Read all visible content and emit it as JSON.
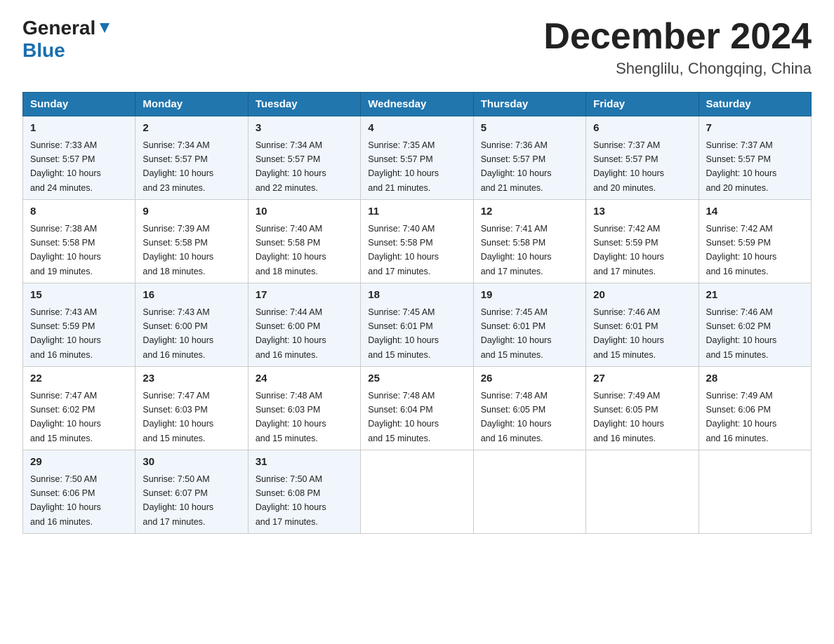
{
  "header": {
    "logo_general": "General",
    "logo_blue": "Blue",
    "month_title": "December 2024",
    "location": "Shenglilu, Chongqing, China"
  },
  "weekdays": [
    "Sunday",
    "Monday",
    "Tuesday",
    "Wednesday",
    "Thursday",
    "Friday",
    "Saturday"
  ],
  "weeks": [
    [
      {
        "day": "1",
        "info": "Sunrise: 7:33 AM\nSunset: 5:57 PM\nDaylight: 10 hours\nand 24 minutes."
      },
      {
        "day": "2",
        "info": "Sunrise: 7:34 AM\nSunset: 5:57 PM\nDaylight: 10 hours\nand 23 minutes."
      },
      {
        "day": "3",
        "info": "Sunrise: 7:34 AM\nSunset: 5:57 PM\nDaylight: 10 hours\nand 22 minutes."
      },
      {
        "day": "4",
        "info": "Sunrise: 7:35 AM\nSunset: 5:57 PM\nDaylight: 10 hours\nand 21 minutes."
      },
      {
        "day": "5",
        "info": "Sunrise: 7:36 AM\nSunset: 5:57 PM\nDaylight: 10 hours\nand 21 minutes."
      },
      {
        "day": "6",
        "info": "Sunrise: 7:37 AM\nSunset: 5:57 PM\nDaylight: 10 hours\nand 20 minutes."
      },
      {
        "day": "7",
        "info": "Sunrise: 7:37 AM\nSunset: 5:57 PM\nDaylight: 10 hours\nand 20 minutes."
      }
    ],
    [
      {
        "day": "8",
        "info": "Sunrise: 7:38 AM\nSunset: 5:58 PM\nDaylight: 10 hours\nand 19 minutes."
      },
      {
        "day": "9",
        "info": "Sunrise: 7:39 AM\nSunset: 5:58 PM\nDaylight: 10 hours\nand 18 minutes."
      },
      {
        "day": "10",
        "info": "Sunrise: 7:40 AM\nSunset: 5:58 PM\nDaylight: 10 hours\nand 18 minutes."
      },
      {
        "day": "11",
        "info": "Sunrise: 7:40 AM\nSunset: 5:58 PM\nDaylight: 10 hours\nand 17 minutes."
      },
      {
        "day": "12",
        "info": "Sunrise: 7:41 AM\nSunset: 5:58 PM\nDaylight: 10 hours\nand 17 minutes."
      },
      {
        "day": "13",
        "info": "Sunrise: 7:42 AM\nSunset: 5:59 PM\nDaylight: 10 hours\nand 17 minutes."
      },
      {
        "day": "14",
        "info": "Sunrise: 7:42 AM\nSunset: 5:59 PM\nDaylight: 10 hours\nand 16 minutes."
      }
    ],
    [
      {
        "day": "15",
        "info": "Sunrise: 7:43 AM\nSunset: 5:59 PM\nDaylight: 10 hours\nand 16 minutes."
      },
      {
        "day": "16",
        "info": "Sunrise: 7:43 AM\nSunset: 6:00 PM\nDaylight: 10 hours\nand 16 minutes."
      },
      {
        "day": "17",
        "info": "Sunrise: 7:44 AM\nSunset: 6:00 PM\nDaylight: 10 hours\nand 16 minutes."
      },
      {
        "day": "18",
        "info": "Sunrise: 7:45 AM\nSunset: 6:01 PM\nDaylight: 10 hours\nand 15 minutes."
      },
      {
        "day": "19",
        "info": "Sunrise: 7:45 AM\nSunset: 6:01 PM\nDaylight: 10 hours\nand 15 minutes."
      },
      {
        "day": "20",
        "info": "Sunrise: 7:46 AM\nSunset: 6:01 PM\nDaylight: 10 hours\nand 15 minutes."
      },
      {
        "day": "21",
        "info": "Sunrise: 7:46 AM\nSunset: 6:02 PM\nDaylight: 10 hours\nand 15 minutes."
      }
    ],
    [
      {
        "day": "22",
        "info": "Sunrise: 7:47 AM\nSunset: 6:02 PM\nDaylight: 10 hours\nand 15 minutes."
      },
      {
        "day": "23",
        "info": "Sunrise: 7:47 AM\nSunset: 6:03 PM\nDaylight: 10 hours\nand 15 minutes."
      },
      {
        "day": "24",
        "info": "Sunrise: 7:48 AM\nSunset: 6:03 PM\nDaylight: 10 hours\nand 15 minutes."
      },
      {
        "day": "25",
        "info": "Sunrise: 7:48 AM\nSunset: 6:04 PM\nDaylight: 10 hours\nand 15 minutes."
      },
      {
        "day": "26",
        "info": "Sunrise: 7:48 AM\nSunset: 6:05 PM\nDaylight: 10 hours\nand 16 minutes."
      },
      {
        "day": "27",
        "info": "Sunrise: 7:49 AM\nSunset: 6:05 PM\nDaylight: 10 hours\nand 16 minutes."
      },
      {
        "day": "28",
        "info": "Sunrise: 7:49 AM\nSunset: 6:06 PM\nDaylight: 10 hours\nand 16 minutes."
      }
    ],
    [
      {
        "day": "29",
        "info": "Sunrise: 7:50 AM\nSunset: 6:06 PM\nDaylight: 10 hours\nand 16 minutes."
      },
      {
        "day": "30",
        "info": "Sunrise: 7:50 AM\nSunset: 6:07 PM\nDaylight: 10 hours\nand 17 minutes."
      },
      {
        "day": "31",
        "info": "Sunrise: 7:50 AM\nSunset: 6:08 PM\nDaylight: 10 hours\nand 17 minutes."
      },
      null,
      null,
      null,
      null
    ]
  ],
  "colors": {
    "header_bg": "#2176ae",
    "header_text": "#ffffff",
    "row_odd_bg": "#f0f6fb",
    "row_even_bg": "#ffffff"
  }
}
